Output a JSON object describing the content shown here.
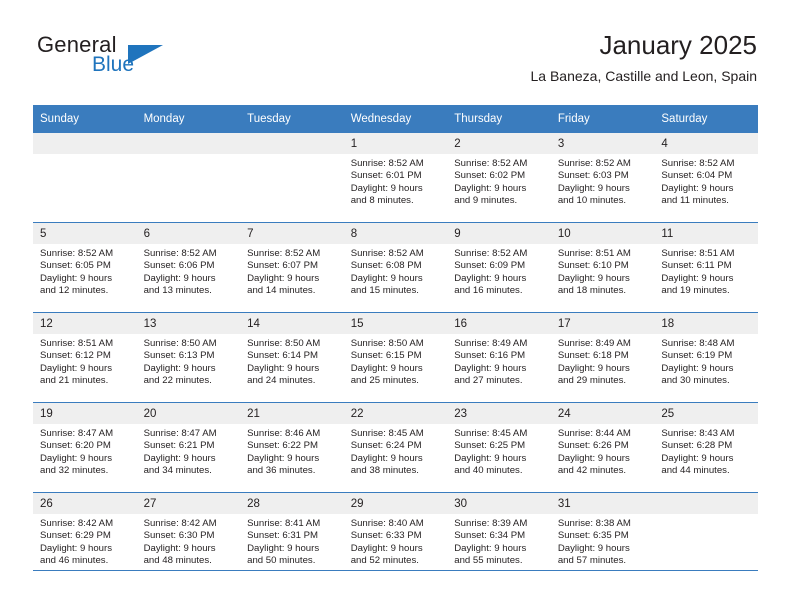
{
  "logo": {
    "text_top": "General",
    "text_bottom": "Blue",
    "accent_color": "#1f74bd"
  },
  "header": {
    "title": "January 2025",
    "subtitle": "La Baneza, Castille and Leon, Spain"
  },
  "theme": {
    "header_blue": "#3a7cbe",
    "daynum_band": "#efefef",
    "text": "#231f20"
  },
  "weekday_headers": [
    "Sunday",
    "Monday",
    "Tuesday",
    "Wednesday",
    "Thursday",
    "Friday",
    "Saturday"
  ],
  "weeks": [
    [
      {
        "day": "",
        "sunrise": "",
        "sunset": "",
        "daylight_line1": "",
        "daylight_line2": ""
      },
      {
        "day": "",
        "sunrise": "",
        "sunset": "",
        "daylight_line1": "",
        "daylight_line2": ""
      },
      {
        "day": "",
        "sunrise": "",
        "sunset": "",
        "daylight_line1": "",
        "daylight_line2": ""
      },
      {
        "day": "1",
        "sunrise": "Sunrise: 8:52 AM",
        "sunset": "Sunset: 6:01 PM",
        "daylight_line1": "Daylight: 9 hours",
        "daylight_line2": "and 8 minutes."
      },
      {
        "day": "2",
        "sunrise": "Sunrise: 8:52 AM",
        "sunset": "Sunset: 6:02 PM",
        "daylight_line1": "Daylight: 9 hours",
        "daylight_line2": "and 9 minutes."
      },
      {
        "day": "3",
        "sunrise": "Sunrise: 8:52 AM",
        "sunset": "Sunset: 6:03 PM",
        "daylight_line1": "Daylight: 9 hours",
        "daylight_line2": "and 10 minutes."
      },
      {
        "day": "4",
        "sunrise": "Sunrise: 8:52 AM",
        "sunset": "Sunset: 6:04 PM",
        "daylight_line1": "Daylight: 9 hours",
        "daylight_line2": "and 11 minutes."
      }
    ],
    [
      {
        "day": "5",
        "sunrise": "Sunrise: 8:52 AM",
        "sunset": "Sunset: 6:05 PM",
        "daylight_line1": "Daylight: 9 hours",
        "daylight_line2": "and 12 minutes."
      },
      {
        "day": "6",
        "sunrise": "Sunrise: 8:52 AM",
        "sunset": "Sunset: 6:06 PM",
        "daylight_line1": "Daylight: 9 hours",
        "daylight_line2": "and 13 minutes."
      },
      {
        "day": "7",
        "sunrise": "Sunrise: 8:52 AM",
        "sunset": "Sunset: 6:07 PM",
        "daylight_line1": "Daylight: 9 hours",
        "daylight_line2": "and 14 minutes."
      },
      {
        "day": "8",
        "sunrise": "Sunrise: 8:52 AM",
        "sunset": "Sunset: 6:08 PM",
        "daylight_line1": "Daylight: 9 hours",
        "daylight_line2": "and 15 minutes."
      },
      {
        "day": "9",
        "sunrise": "Sunrise: 8:52 AM",
        "sunset": "Sunset: 6:09 PM",
        "daylight_line1": "Daylight: 9 hours",
        "daylight_line2": "and 16 minutes."
      },
      {
        "day": "10",
        "sunrise": "Sunrise: 8:51 AM",
        "sunset": "Sunset: 6:10 PM",
        "daylight_line1": "Daylight: 9 hours",
        "daylight_line2": "and 18 minutes."
      },
      {
        "day": "11",
        "sunrise": "Sunrise: 8:51 AM",
        "sunset": "Sunset: 6:11 PM",
        "daylight_line1": "Daylight: 9 hours",
        "daylight_line2": "and 19 minutes."
      }
    ],
    [
      {
        "day": "12",
        "sunrise": "Sunrise: 8:51 AM",
        "sunset": "Sunset: 6:12 PM",
        "daylight_line1": "Daylight: 9 hours",
        "daylight_line2": "and 21 minutes."
      },
      {
        "day": "13",
        "sunrise": "Sunrise: 8:50 AM",
        "sunset": "Sunset: 6:13 PM",
        "daylight_line1": "Daylight: 9 hours",
        "daylight_line2": "and 22 minutes."
      },
      {
        "day": "14",
        "sunrise": "Sunrise: 8:50 AM",
        "sunset": "Sunset: 6:14 PM",
        "daylight_line1": "Daylight: 9 hours",
        "daylight_line2": "and 24 minutes."
      },
      {
        "day": "15",
        "sunrise": "Sunrise: 8:50 AM",
        "sunset": "Sunset: 6:15 PM",
        "daylight_line1": "Daylight: 9 hours",
        "daylight_line2": "and 25 minutes."
      },
      {
        "day": "16",
        "sunrise": "Sunrise: 8:49 AM",
        "sunset": "Sunset: 6:16 PM",
        "daylight_line1": "Daylight: 9 hours",
        "daylight_line2": "and 27 minutes."
      },
      {
        "day": "17",
        "sunrise": "Sunrise: 8:49 AM",
        "sunset": "Sunset: 6:18 PM",
        "daylight_line1": "Daylight: 9 hours",
        "daylight_line2": "and 29 minutes."
      },
      {
        "day": "18",
        "sunrise": "Sunrise: 8:48 AM",
        "sunset": "Sunset: 6:19 PM",
        "daylight_line1": "Daylight: 9 hours",
        "daylight_line2": "and 30 minutes."
      }
    ],
    [
      {
        "day": "19",
        "sunrise": "Sunrise: 8:47 AM",
        "sunset": "Sunset: 6:20 PM",
        "daylight_line1": "Daylight: 9 hours",
        "daylight_line2": "and 32 minutes."
      },
      {
        "day": "20",
        "sunrise": "Sunrise: 8:47 AM",
        "sunset": "Sunset: 6:21 PM",
        "daylight_line1": "Daylight: 9 hours",
        "daylight_line2": "and 34 minutes."
      },
      {
        "day": "21",
        "sunrise": "Sunrise: 8:46 AM",
        "sunset": "Sunset: 6:22 PM",
        "daylight_line1": "Daylight: 9 hours",
        "daylight_line2": "and 36 minutes."
      },
      {
        "day": "22",
        "sunrise": "Sunrise: 8:45 AM",
        "sunset": "Sunset: 6:24 PM",
        "daylight_line1": "Daylight: 9 hours",
        "daylight_line2": "and 38 minutes."
      },
      {
        "day": "23",
        "sunrise": "Sunrise: 8:45 AM",
        "sunset": "Sunset: 6:25 PM",
        "daylight_line1": "Daylight: 9 hours",
        "daylight_line2": "and 40 minutes."
      },
      {
        "day": "24",
        "sunrise": "Sunrise: 8:44 AM",
        "sunset": "Sunset: 6:26 PM",
        "daylight_line1": "Daylight: 9 hours",
        "daylight_line2": "and 42 minutes."
      },
      {
        "day": "25",
        "sunrise": "Sunrise: 8:43 AM",
        "sunset": "Sunset: 6:28 PM",
        "daylight_line1": "Daylight: 9 hours",
        "daylight_line2": "and 44 minutes."
      }
    ],
    [
      {
        "day": "26",
        "sunrise": "Sunrise: 8:42 AM",
        "sunset": "Sunset: 6:29 PM",
        "daylight_line1": "Daylight: 9 hours",
        "daylight_line2": "and 46 minutes."
      },
      {
        "day": "27",
        "sunrise": "Sunrise: 8:42 AM",
        "sunset": "Sunset: 6:30 PM",
        "daylight_line1": "Daylight: 9 hours",
        "daylight_line2": "and 48 minutes."
      },
      {
        "day": "28",
        "sunrise": "Sunrise: 8:41 AM",
        "sunset": "Sunset: 6:31 PM",
        "daylight_line1": "Daylight: 9 hours",
        "daylight_line2": "and 50 minutes."
      },
      {
        "day": "29",
        "sunrise": "Sunrise: 8:40 AM",
        "sunset": "Sunset: 6:33 PM",
        "daylight_line1": "Daylight: 9 hours",
        "daylight_line2": "and 52 minutes."
      },
      {
        "day": "30",
        "sunrise": "Sunrise: 8:39 AM",
        "sunset": "Sunset: 6:34 PM",
        "daylight_line1": "Daylight: 9 hours",
        "daylight_line2": "and 55 minutes."
      },
      {
        "day": "31",
        "sunrise": "Sunrise: 8:38 AM",
        "sunset": "Sunset: 6:35 PM",
        "daylight_line1": "Daylight: 9 hours",
        "daylight_line2": "and 57 minutes."
      },
      {
        "day": "",
        "sunrise": "",
        "sunset": "",
        "daylight_line1": "",
        "daylight_line2": ""
      }
    ]
  ]
}
